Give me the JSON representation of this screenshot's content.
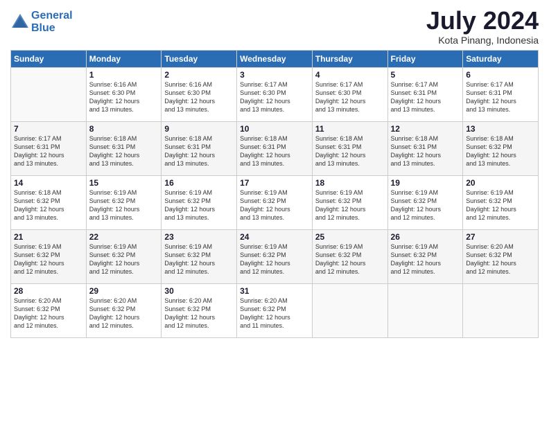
{
  "logo": {
    "text_general": "General",
    "text_blue": "Blue"
  },
  "header": {
    "month_year": "July 2024",
    "location": "Kota Pinang, Indonesia"
  },
  "weekdays": [
    "Sunday",
    "Monday",
    "Tuesday",
    "Wednesday",
    "Thursday",
    "Friday",
    "Saturday"
  ],
  "weeks": [
    [
      {
        "day": "",
        "info": ""
      },
      {
        "day": "1",
        "info": "Sunrise: 6:16 AM\nSunset: 6:30 PM\nDaylight: 12 hours\nand 13 minutes."
      },
      {
        "day": "2",
        "info": "Sunrise: 6:16 AM\nSunset: 6:30 PM\nDaylight: 12 hours\nand 13 minutes."
      },
      {
        "day": "3",
        "info": "Sunrise: 6:17 AM\nSunset: 6:30 PM\nDaylight: 12 hours\nand 13 minutes."
      },
      {
        "day": "4",
        "info": "Sunrise: 6:17 AM\nSunset: 6:30 PM\nDaylight: 12 hours\nand 13 minutes."
      },
      {
        "day": "5",
        "info": "Sunrise: 6:17 AM\nSunset: 6:31 PM\nDaylight: 12 hours\nand 13 minutes."
      },
      {
        "day": "6",
        "info": "Sunrise: 6:17 AM\nSunset: 6:31 PM\nDaylight: 12 hours\nand 13 minutes."
      }
    ],
    [
      {
        "day": "7",
        "info": ""
      },
      {
        "day": "8",
        "info": "Sunrise: 6:18 AM\nSunset: 6:31 PM\nDaylight: 12 hours\nand 13 minutes."
      },
      {
        "day": "9",
        "info": "Sunrise: 6:18 AM\nSunset: 6:31 PM\nDaylight: 12 hours\nand 13 minutes."
      },
      {
        "day": "10",
        "info": "Sunrise: 6:18 AM\nSunset: 6:31 PM\nDaylight: 12 hours\nand 13 minutes."
      },
      {
        "day": "11",
        "info": "Sunrise: 6:18 AM\nSunset: 6:31 PM\nDaylight: 12 hours\nand 13 minutes."
      },
      {
        "day": "12",
        "info": "Sunrise: 6:18 AM\nSunset: 6:31 PM\nDaylight: 12 hours\nand 13 minutes."
      },
      {
        "day": "13",
        "info": "Sunrise: 6:18 AM\nSunset: 6:32 PM\nDaylight: 12 hours\nand 13 minutes."
      }
    ],
    [
      {
        "day": "14",
        "info": ""
      },
      {
        "day": "15",
        "info": "Sunrise: 6:19 AM\nSunset: 6:32 PM\nDaylight: 12 hours\nand 13 minutes."
      },
      {
        "day": "16",
        "info": "Sunrise: 6:19 AM\nSunset: 6:32 PM\nDaylight: 12 hours\nand 13 minutes."
      },
      {
        "day": "17",
        "info": "Sunrise: 6:19 AM\nSunset: 6:32 PM\nDaylight: 12 hours\nand 13 minutes."
      },
      {
        "day": "18",
        "info": "Sunrise: 6:19 AM\nSunset: 6:32 PM\nDaylight: 12 hours\nand 12 minutes."
      },
      {
        "day": "19",
        "info": "Sunrise: 6:19 AM\nSunset: 6:32 PM\nDaylight: 12 hours\nand 12 minutes."
      },
      {
        "day": "20",
        "info": "Sunrise: 6:19 AM\nSunset: 6:32 PM\nDaylight: 12 hours\nand 12 minutes."
      }
    ],
    [
      {
        "day": "21",
        "info": "Sunrise: 6:19 AM\nSunset: 6:32 PM\nDaylight: 12 hours\nand 12 minutes."
      },
      {
        "day": "22",
        "info": "Sunrise: 6:19 AM\nSunset: 6:32 PM\nDaylight: 12 hours\nand 12 minutes."
      },
      {
        "day": "23",
        "info": "Sunrise: 6:19 AM\nSunset: 6:32 PM\nDaylight: 12 hours\nand 12 minutes."
      },
      {
        "day": "24",
        "info": "Sunrise: 6:19 AM\nSunset: 6:32 PM\nDaylight: 12 hours\nand 12 minutes."
      },
      {
        "day": "25",
        "info": "Sunrise: 6:19 AM\nSunset: 6:32 PM\nDaylight: 12 hours\nand 12 minutes."
      },
      {
        "day": "26",
        "info": "Sunrise: 6:19 AM\nSunset: 6:32 PM\nDaylight: 12 hours\nand 12 minutes."
      },
      {
        "day": "27",
        "info": "Sunrise: 6:20 AM\nSunset: 6:32 PM\nDaylight: 12 hours\nand 12 minutes."
      }
    ],
    [
      {
        "day": "28",
        "info": "Sunrise: 6:20 AM\nSunset: 6:32 PM\nDaylight: 12 hours\nand 12 minutes."
      },
      {
        "day": "29",
        "info": "Sunrise: 6:20 AM\nSunset: 6:32 PM\nDaylight: 12 hours\nand 12 minutes."
      },
      {
        "day": "30",
        "info": "Sunrise: 6:20 AM\nSunset: 6:32 PM\nDaylight: 12 hours\nand 12 minutes."
      },
      {
        "day": "31",
        "info": "Sunrise: 6:20 AM\nSunset: 6:32 PM\nDaylight: 12 hours\nand 11 minutes."
      },
      {
        "day": "",
        "info": ""
      },
      {
        "day": "",
        "info": ""
      },
      {
        "day": "",
        "info": ""
      }
    ]
  ],
  "week7": {
    "day": "7",
    "info": "Sunrise: 6:17 AM\nSunset: 6:31 PM\nDaylight: 12 hours\nand 13 minutes."
  },
  "week14": {
    "day": "14",
    "info": "Sunrise: 6:18 AM\nSunset: 6:32 PM\nDaylight: 12 hours\nand 13 minutes."
  }
}
